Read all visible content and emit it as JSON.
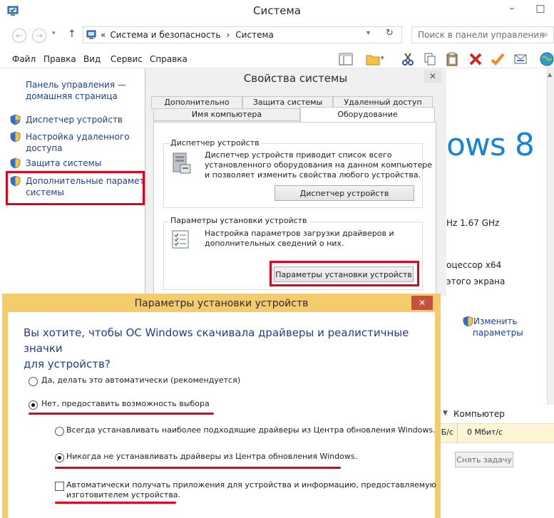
{
  "main_window": {
    "title": "Система",
    "app_icon": "system-window-icon",
    "controls": {
      "minimize": "–",
      "maximize": "□"
    },
    "address": {
      "chevron": "«",
      "segment1": "Система и безопасность",
      "separator": "›",
      "segment2": "Система"
    },
    "search_placeholder": "Поиск в панели управления",
    "menu": [
      "Файл",
      "Правка",
      "Вид",
      "Сервис",
      "Справка"
    ],
    "toolbar_icons": [
      "layout-icon",
      "folder-icon",
      "cut-icon",
      "copy-icon",
      "paste-icon",
      "delete-icon",
      "checkmark-icon",
      "mail-icon",
      "globe-icon"
    ],
    "left_pane": {
      "home_link": [
        "Панель управления —",
        "домашняя страница"
      ],
      "links": [
        {
          "lines": [
            "Диспетчер устройств"
          ]
        },
        {
          "lines": [
            "Настройка удаленного",
            "доступа"
          ]
        },
        {
          "lines": [
            "Защита системы"
          ]
        },
        {
          "lines": [
            "Дополнительные параметры",
            "системы"
          ]
        }
      ]
    },
    "right_pane": {
      "windows_logo_text": "ows 8",
      "cpu_speed": "Hz   1.67 GHz",
      "processor_type": "оцессор x64",
      "display_text": "этого экрана",
      "change_settings": [
        "Изменить",
        "параметры"
      ],
      "computer_label": "Компьютер",
      "network_values": [
        "Б/с",
        "0 Мбит/с"
      ],
      "end_task": "Снять задачу"
    }
  },
  "system_properties": {
    "title": "Свойства системы",
    "close": "✕",
    "tabs_back": [
      "Дополнительно",
      "Защита системы",
      "Удаленный доступ"
    ],
    "tabs_front": [
      "Имя компьютера",
      "Оборудование"
    ],
    "device_manager_group": {
      "label": "Диспетчер устройств",
      "text": [
        "Диспетчер устройств приводит список всего",
        "установленного оборудования на данном компьютере",
        "и позволяет изменить свойства любого устройства."
      ],
      "button": "Диспетчер устройств"
    },
    "install_settings_group": {
      "label": "Параметры установки устройств",
      "text": [
        "Настройка параметров загрузки драйверов и",
        "дополнительных сведений о них."
      ],
      "button": "Параметры установки устройств"
    }
  },
  "device_install_dialog": {
    "title": "Параметры установки устройств",
    "close": "✕",
    "question": [
      "Вы хотите, чтобы ОС Windows скачивала драйверы и реалистичные значки",
      "для устройств?"
    ],
    "option_auto": "Да, делать это автоматически (рекомендуется)",
    "option_choose": "Нет, предоставить возможность выбора",
    "sub_always": "Всегда устанавливать наиболее подходящие драйверы из Центра обновления Windows.",
    "sub_never": "Никогда не устанавливать драйверы из Центра обновления Windows.",
    "auto_apps": [
      "Автоматически получать приложения для устройства и информацию, предоставляемую",
      "изготовителем устройства."
    ],
    "selected_option": "option_choose",
    "selected_sub": "sub_never",
    "auto_apps_checked": false
  },
  "colors": {
    "highlight": "#e0001b",
    "link": "#1c3f95",
    "windows_blue": "#1883d7",
    "dialog_frame": "#f4cc6d",
    "close_button": "#c7513d"
  }
}
